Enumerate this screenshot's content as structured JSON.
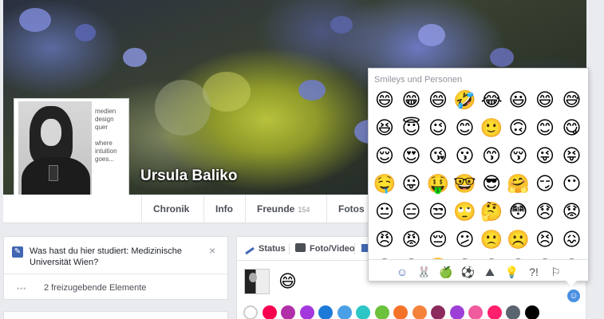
{
  "profile": {
    "name": "Ursula Baliko",
    "pic_text": [
      "medien",
      "design",
      "quer",
      "where",
      "intuition",
      "goes..."
    ]
  },
  "nav": {
    "tabs": [
      {
        "label": "Chronik"
      },
      {
        "label": "Info"
      },
      {
        "label": "Freunde",
        "count": "154"
      },
      {
        "label": "Fotos"
      }
    ]
  },
  "education_prompt": {
    "text": "Was hast du hier studiert: Medizinische Universität Wien?",
    "close": "×"
  },
  "pending": {
    "icon": "•••",
    "text": "2 freizugebende Elemente"
  },
  "composer": {
    "tabs": [
      {
        "label": "Status"
      },
      {
        "label": "Foto/Video"
      }
    ],
    "emoji": "😄",
    "swatches": [
      "#ffffff",
      "#f7004f",
      "#b12fa8",
      "#a338dd",
      "#1d7ad9",
      "#4aa0e6",
      "#2dc6c6",
      "#6cc13d",
      "#f57329",
      "#f4823a",
      "#8c2a5e",
      "#9d3fd7",
      "#ef5b9d",
      "#ff1f6b",
      "#5b6570",
      "#000000"
    ]
  },
  "picker": {
    "title": "Smileys und Personen",
    "emojis": [
      "😄",
      "😁",
      "😄",
      "🤣",
      "😂",
      "😃",
      "😄",
      "😅",
      "😆",
      "😇",
      "😉",
      "😊",
      "🙂",
      "🙃",
      "😊",
      "😋",
      "😌",
      "😍",
      "😘",
      "😗",
      "😙",
      "😚",
      "😜",
      "😝",
      "🤤",
      "😛",
      "🤑",
      "🤓",
      "😎",
      "🤗",
      "😏",
      "😶",
      "😐",
      "😑",
      "😒",
      "🙄",
      "🤔",
      "😳",
      "😞",
      "😟",
      "😠",
      "😡",
      "😔",
      "😕",
      "🙁",
      "☹️",
      "😣",
      "😖",
      "😫",
      "😩",
      "😤",
      "😮",
      "😱",
      "😨",
      "😰",
      "😯"
    ],
    "categories": [
      {
        "icon": "smiley-icon",
        "glyph": "☺"
      },
      {
        "icon": "bunny-icon",
        "glyph": "🐰"
      },
      {
        "icon": "apple-icon",
        "glyph": "🍏"
      },
      {
        "icon": "soccer-ball-icon",
        "glyph": "⚽"
      },
      {
        "icon": "mountain-icon",
        "glyph": "⛰"
      },
      {
        "icon": "lightbulb-icon",
        "glyph": "💡"
      },
      {
        "icon": "symbols-icon",
        "glyph": "?!"
      },
      {
        "icon": "flag-icon",
        "glyph": "⚐"
      }
    ],
    "toggle_glyph": "☺"
  }
}
